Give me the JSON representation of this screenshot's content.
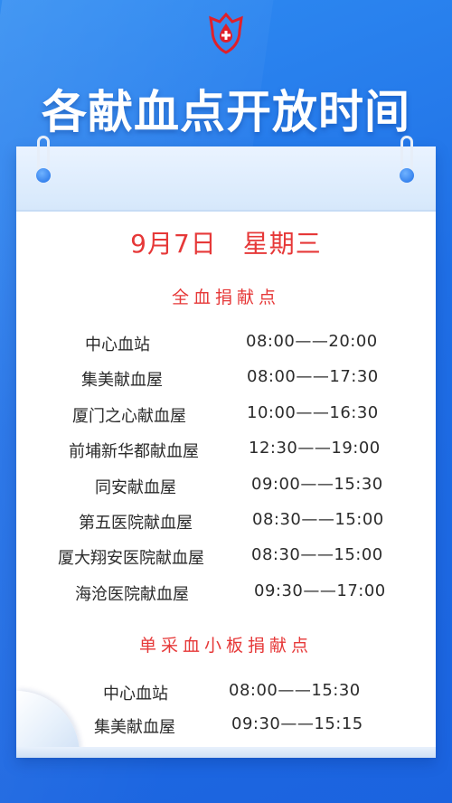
{
  "title": "各献血点开放时间",
  "date": "9月7日　星期三",
  "whole_blood": {
    "heading": "全血捐献点",
    "rows": [
      {
        "name": "中心血站",
        "time": "08:00——20:00"
      },
      {
        "name": "集美献血屋",
        "time": "08:00——17:30"
      },
      {
        "name": "厦门之心献血屋",
        "time": "10:00——16:30"
      },
      {
        "name": "前埔新华都献血屋",
        "time": "12:30——19:00"
      },
      {
        "name": "同安献血屋",
        "time": "09:00——15:30"
      },
      {
        "name": "第五医院献血屋",
        "time": "08:30——15:00"
      },
      {
        "name": "厦大翔安医院献血屋",
        "time": "08:30——15:00"
      },
      {
        "name": "海沧医院献血屋",
        "time": "09:30——17:00"
      }
    ]
  },
  "platelet": {
    "heading": "单采血小板捐献点",
    "rows": [
      {
        "name": "中心血站",
        "time": "08:00——15:30"
      },
      {
        "name": "集美献血屋",
        "time": "09:30——15:15"
      }
    ]
  },
  "colors": {
    "accent_red": "#e63838",
    "brand_blue": "#1f6fe6"
  },
  "icons": {
    "logo": "blood-drop-flower-logo-icon"
  }
}
